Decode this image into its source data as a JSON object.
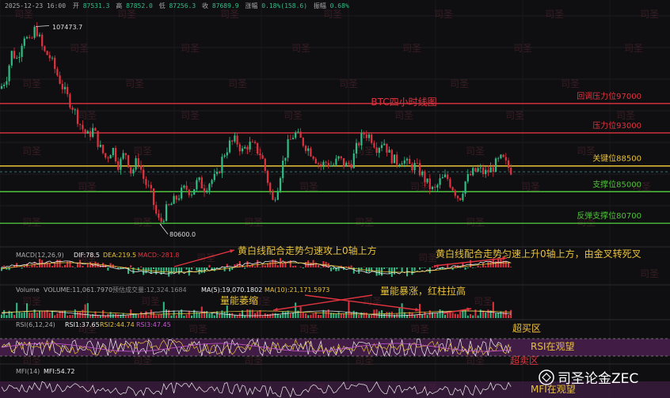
{
  "header": {
    "datetime": "2025-12-23 16:00",
    "open_label": "开",
    "open": "87531.3",
    "high_label": "高",
    "high": "87852.0",
    "low_label": "低",
    "low": "87256.3",
    "close_label": "收",
    "close": "87689.9",
    "change_label": "涨幅",
    "change": "0.18%(158.6)",
    "amp_label": "振幅",
    "amp": "0.68%"
  },
  "main_title": "BTC四小时线图",
  "annotations": {
    "macd_note1": "黄白线配合走势匀速攻上0轴上方",
    "macd_note2": "黄白线配合走势匀速上升0轴上方，由金叉转死叉",
    "vol_note1": "量能萎缩",
    "vol_note2": "量能暴涨，红柱拉高",
    "rsi_overbought": "超买区",
    "rsi_watch": "RSI在观望",
    "rsi_oversold": "超卖区",
    "mfi_watch": "MFI在观望"
  },
  "price_levels": [
    {
      "label": "回调压力位97000",
      "value": 97000,
      "color": "#e0333f"
    },
    {
      "label": "压力位93000",
      "value": 93000,
      "color": "#e0333f"
    },
    {
      "label": "关键位88500",
      "value": 88500,
      "color": "#e8c23a"
    },
    {
      "label": "支撑位85000",
      "value": 85000,
      "color": "#4fc13a"
    },
    {
      "label": "反弹支撑位80700",
      "value": 80700,
      "color": "#4fc13a"
    }
  ],
  "macd_legend": {
    "name": "MACD(12,26,9)",
    "dif": "DIF:78.5",
    "dea": "DEA:219.5",
    "macd": "MACD:-281.8"
  },
  "volume_legend": {
    "name": "Volume",
    "vol": "VOLUME:11,061.7970",
    "pred": "预估成交量:12,324.1684",
    "ma5": "MA(5):19,070.1802",
    "ma10": "MA(10):21,171.5973"
  },
  "rsi_legend": {
    "name": "RSI(6,12,24)",
    "r1": "RSI1:37.65",
    "r2": "RSI2:44.74",
    "r3": "RSI3:47.45"
  },
  "mfi_legend": {
    "name": "MFI(14)",
    "v": "MFI:54.72"
  },
  "watermark": "司圣",
  "brand": "司圣论金ZEC",
  "colors": {
    "up": "#2fbd85",
    "down": "#e0333f",
    "background": "#0f0f12",
    "yellow": "#e8c23a",
    "green": "#7ddc4a",
    "rsi_band": "#4a1f4f"
  },
  "chart_data": {
    "type": "candlestick",
    "title": "BTC四小时线图",
    "high_marker": "107473.7",
    "low_marker": "80600.0",
    "price_path": [
      [
        0,
        99000
      ],
      [
        8,
        100500
      ],
      [
        15,
        104000
      ],
      [
        22,
        103000
      ],
      [
        30,
        106500
      ],
      [
        38,
        105000
      ],
      [
        45,
        107473
      ],
      [
        55,
        104000
      ],
      [
        62,
        103500
      ],
      [
        72,
        101000
      ],
      [
        82,
        98500
      ],
      [
        92,
        96500
      ],
      [
        102,
        94000
      ],
      [
        110,
        92500
      ],
      [
        118,
        93500
      ],
      [
        126,
        91000
      ],
      [
        134,
        89500
      ],
      [
        142,
        91000
      ],
      [
        150,
        88500
      ],
      [
        158,
        90500
      ],
      [
        166,
        87500
      ],
      [
        174,
        89500
      ],
      [
        182,
        86500
      ],
      [
        190,
        85000
      ],
      [
        197,
        82000
      ],
      [
        202,
        80600
      ],
      [
        210,
        82500
      ],
      [
        218,
        83500
      ],
      [
        226,
        84500
      ],
      [
        234,
        85500
      ],
      [
        242,
        85000
      ],
      [
        250,
        86500
      ],
      [
        258,
        85500
      ],
      [
        266,
        86500
      ],
      [
        274,
        87000
      ],
      [
        282,
        90000
      ],
      [
        290,
        91500
      ],
      [
        298,
        92000
      ],
      [
        306,
        90500
      ],
      [
        314,
        91500
      ],
      [
        322,
        91000
      ],
      [
        330,
        90000
      ],
      [
        338,
        86500
      ],
      [
        344,
        83500
      ],
      [
        350,
        85500
      ],
      [
        356,
        88500
      ],
      [
        364,
        91500
      ],
      [
        372,
        93000
      ],
      [
        380,
        92000
      ],
      [
        388,
        91000
      ],
      [
        396,
        90000
      ],
      [
        404,
        88500
      ],
      [
        412,
        89000
      ],
      [
        420,
        88500
      ],
      [
        428,
        89500
      ],
      [
        436,
        88500
      ],
      [
        444,
        89000
      ],
      [
        452,
        91500
      ],
      [
        460,
        93000
      ],
      [
        468,
        92500
      ],
      [
        476,
        91000
      ],
      [
        484,
        92000
      ],
      [
        492,
        90000
      ],
      [
        500,
        89000
      ],
      [
        508,
        89500
      ],
      [
        516,
        88500
      ],
      [
        524,
        88500
      ],
      [
        532,
        87500
      ],
      [
        540,
        86000
      ],
      [
        548,
        85000
      ],
      [
        556,
        86500
      ],
      [
        564,
        87000
      ],
      [
        572,
        85500
      ],
      [
        580,
        84000
      ],
      [
        588,
        86500
      ],
      [
        596,
        87500
      ],
      [
        604,
        88000
      ],
      [
        612,
        87500
      ],
      [
        620,
        88000
      ],
      [
        628,
        89000
      ],
      [
        634,
        89500
      ],
      [
        640,
        88500
      ],
      [
        648,
        87700
      ]
    ],
    "price_axis": {
      "ymin": 79000,
      "ymax": 110000
    }
  }
}
